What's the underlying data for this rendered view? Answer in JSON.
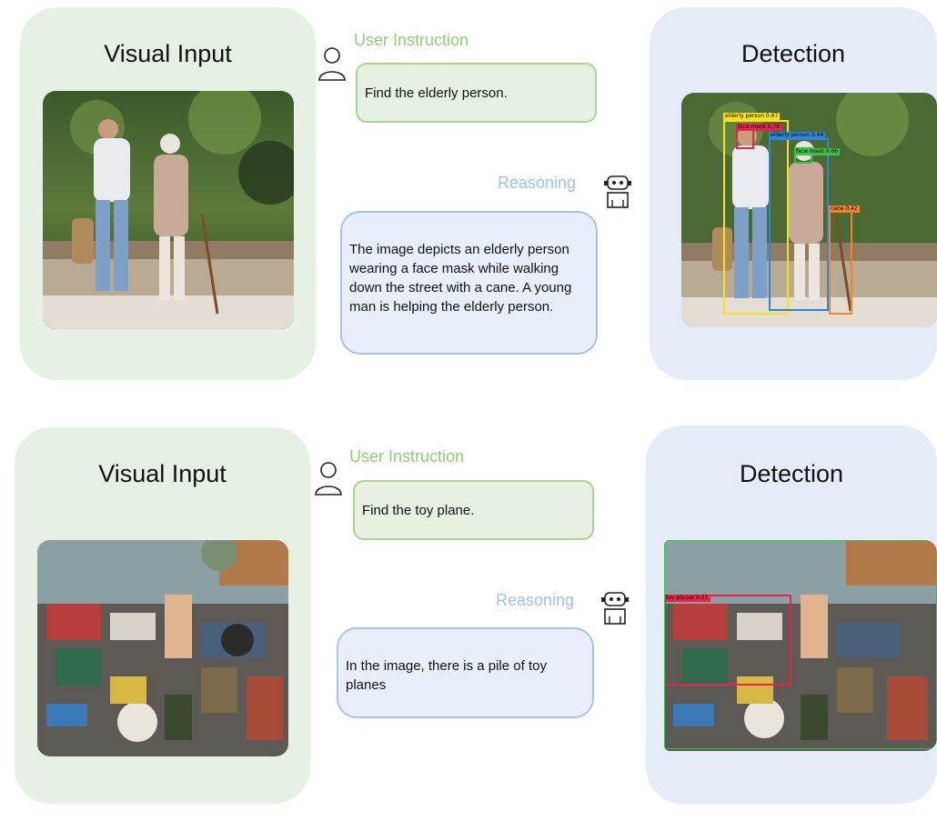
{
  "examples": [
    {
      "visual_input_title": "Visual Input",
      "detection_title": "Detection",
      "user_label": "User Instruction",
      "instruction": "Find the elderly person.",
      "reasoning_label": "Reasoning",
      "reasoning": "The image depicts an elderly person wearing a face mask while walking down the street with a cane. A young man is helping the elderly person.",
      "detections": [
        {
          "label": "elderly person 0.67",
          "color": "#f5e21a"
        },
        {
          "label": "face mask 0.78",
          "color": "#e8244a"
        },
        {
          "label": "elderly person 0.64",
          "color": "#2f86d6"
        },
        {
          "label": "face mask 0.66",
          "color": "#3cc24a"
        },
        {
          "label": "cane 0.42",
          "color": "#f2842a"
        }
      ]
    },
    {
      "visual_input_title": "Visual Input",
      "detection_title": "Detection",
      "user_label": "User Instruction",
      "instruction": "Find the toy plane.",
      "reasoning_label": "Reasoning",
      "reasoning": "In the image, there is a pile of toy planes",
      "detections": [
        {
          "label": "toy planes 0.37",
          "color": "#e8244a"
        },
        {
          "label": "",
          "color": "#3cc24a"
        }
      ]
    }
  ],
  "colors": {
    "input_bg": "#e7f0e4",
    "detect_bg": "#e5ecf8",
    "user_label": "#8fcf77",
    "reasoning_label": "#9cc2ee"
  }
}
